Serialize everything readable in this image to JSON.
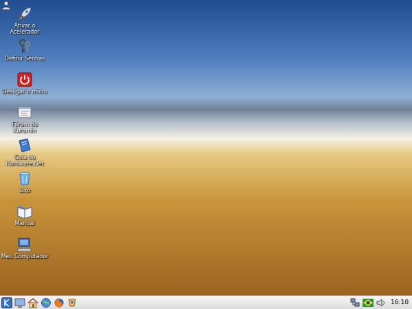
{
  "desktop": {
    "icons": [
      {
        "lines": [
          "Ativar o",
          "Acelerador"
        ]
      },
      {
        "lines": [
          "Definir Senhas"
        ]
      },
      {
        "lines": [
          "Desligar o micro"
        ]
      },
      {
        "lines": [
          "Fórum do",
          "Kurumin"
        ]
      },
      {
        "lines": [
          "Guia do",
          "Hardware.Net"
        ]
      },
      {
        "lines": [
          "Lixo"
        ]
      },
      {
        "lines": [
          "Manual"
        ]
      },
      {
        "lines": [
          "Meu Computador"
        ]
      }
    ]
  },
  "taskbar": {
    "clock": "16:10"
  }
}
